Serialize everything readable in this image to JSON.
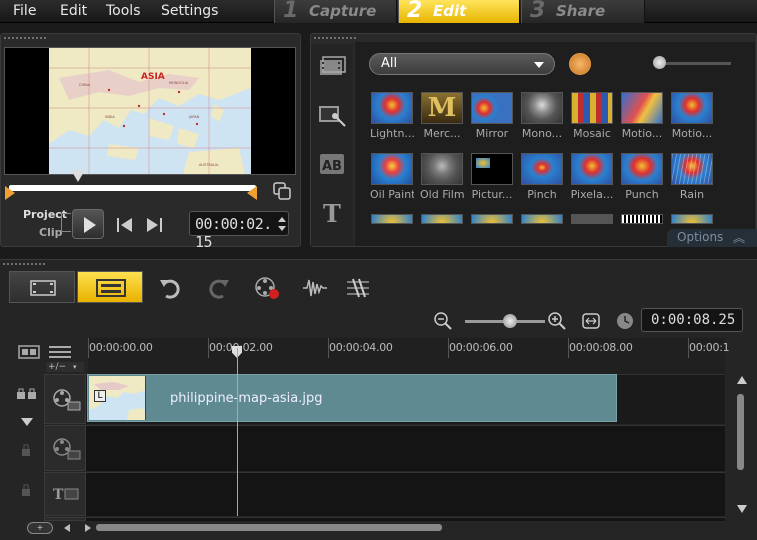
{
  "menu": {
    "items": [
      "File",
      "Edit",
      "Tools",
      "Settings"
    ]
  },
  "steps": [
    {
      "number": "1",
      "label": "Capture"
    },
    {
      "number": "2",
      "label": "Edit"
    },
    {
      "number": "3",
      "label": "Share"
    }
  ],
  "preview": {
    "mode_project": "Project",
    "mode_clip": "Clip",
    "timecode": "00:00:02. 15",
    "map_label": "ASIA"
  },
  "library": {
    "category": "All",
    "options_label": "Options",
    "effects": [
      [
        "Lightn...",
        "Merc...",
        "Mirror",
        "Mono...",
        "Mosaic",
        "Motio...",
        "Motio..."
      ],
      [
        "Oil Paint",
        "Old Film",
        "Pictur...",
        "Pinch",
        "Pixela...",
        "Punch",
        "Rain"
      ]
    ]
  },
  "timeline": {
    "duration": "0:00:08.25",
    "ruler_labels": [
      "00:00:00.00",
      "00:00:02.00",
      "00:00:04.00",
      "00:00:06.00",
      "00:00:08.00",
      "00:00:1"
    ],
    "clip_name": "philippine-map-asia.jpg",
    "add_track_label": "+/−"
  },
  "colors": {
    "accent": "#f2c319",
    "clip": "#5f8a92"
  }
}
